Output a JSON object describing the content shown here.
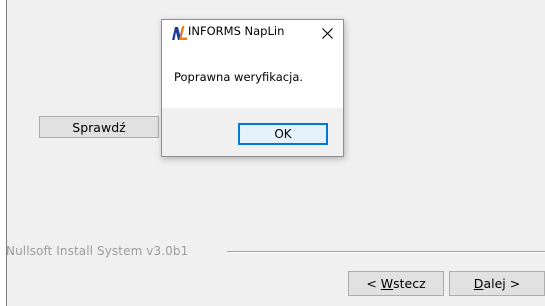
{
  "wizard": {
    "check_button_label": "Sprawdź",
    "branding_text": "Nullsoft Install System v3.0b1",
    "back_button": {
      "prefix": "< ",
      "mnemonic": "W",
      "rest": "stecz"
    },
    "next_button": {
      "mnemonic": "D",
      "rest": "alej >"
    }
  },
  "dialog": {
    "title": "INFORMS NapLin",
    "message": "Poprawna weryfikacja.",
    "ok_label": "OK",
    "close_icon": "close-icon",
    "app_icon": "naplin-logo-icon"
  },
  "colors": {
    "logo_blue": "#1e3a9a",
    "logo_orange": "#f07d1a",
    "focus_blue": "#0078d7",
    "branding_gray": "#9d9d9d"
  }
}
